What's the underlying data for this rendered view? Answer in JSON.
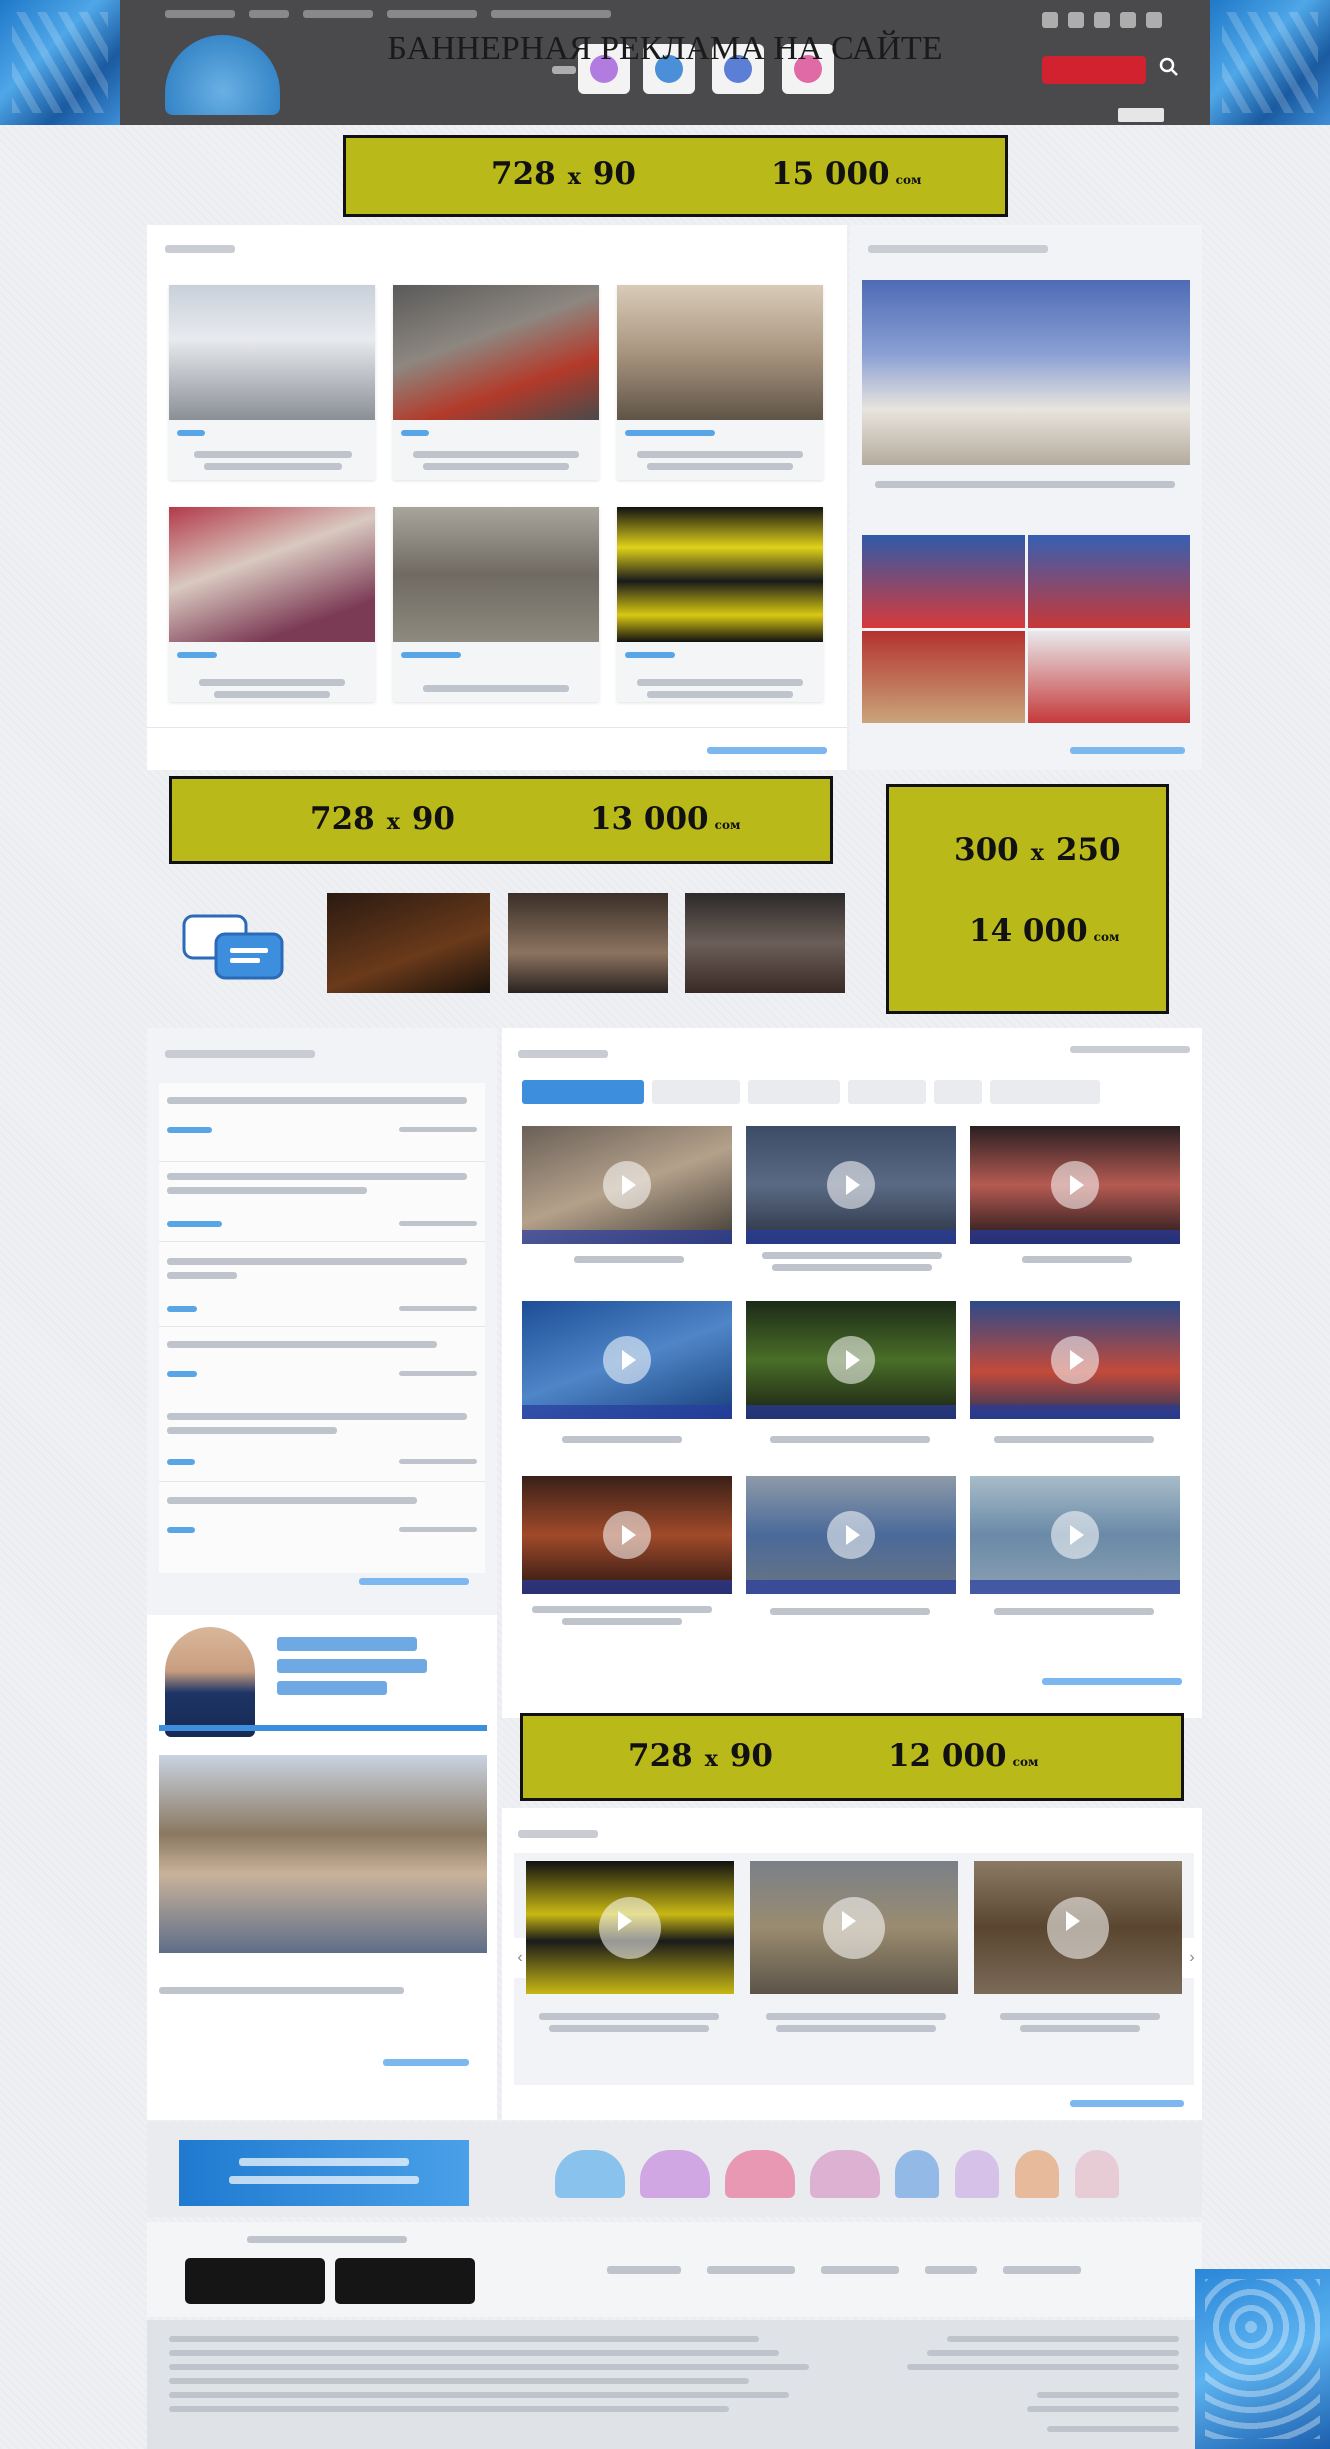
{
  "page": {
    "title": "БАННЕРНАЯ РЕКЛАМА НА САЙТЕ"
  },
  "ads": [
    {
      "size_w": "728",
      "size_x": "x",
      "size_h": "90",
      "price": "15 000",
      "currency": "сом"
    },
    {
      "size_w": "728",
      "size_x": "x",
      "size_h": "90",
      "price": "13 000",
      "currency": "сом"
    },
    {
      "size_w": "300",
      "size_x": "x",
      "size_h": "250",
      "price": "14 000",
      "currency": "сом"
    },
    {
      "size_w": "728",
      "size_x": "x",
      "size_h": "90",
      "price": "12 000",
      "currency": "сом"
    }
  ],
  "icons": {
    "search": "search-icon",
    "live": "live-icon",
    "play": "play-icon",
    "social": [
      "twitter-icon",
      "facebook-icon",
      "telegram-icon",
      "youtube-icon",
      "instagram-icon"
    ],
    "chat": "chat-bubbles-icon",
    "arrow_left": "chevron-left-icon",
    "arrow_right": "chevron-right-icon"
  },
  "colors": {
    "ad_fill": "#b9b91a",
    "header": "#4a4a4c",
    "accent_blue": "#3d8fde",
    "live_red": "#d22230"
  }
}
